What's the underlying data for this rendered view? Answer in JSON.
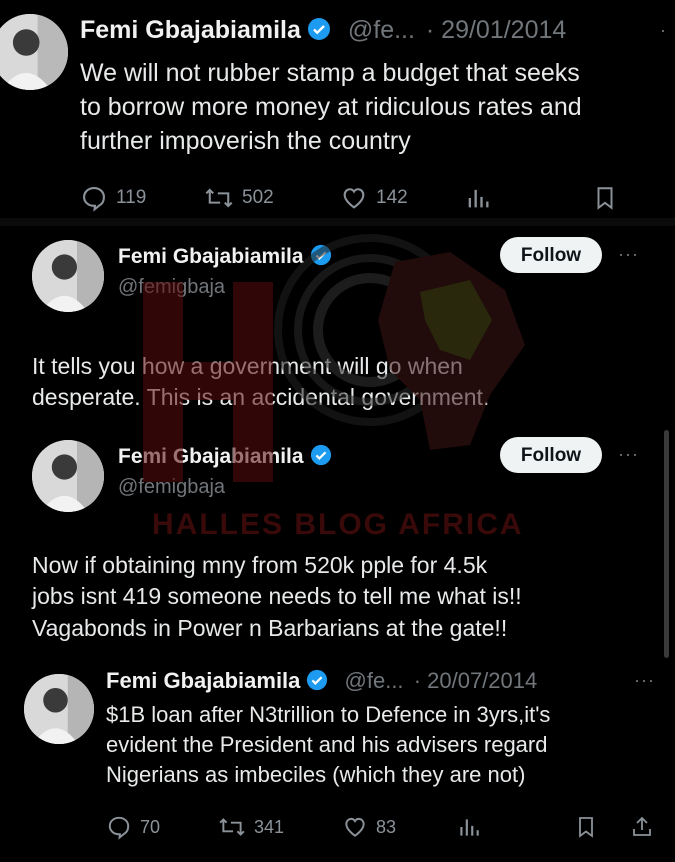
{
  "tweets": [
    {
      "name": "Femi Gbajabiamila",
      "handle_short": "@fe...",
      "date": "· 29/01/2014",
      "text_lines": [
        "We will not rubber stamp a budget that seeks",
        "to borrow more money at ridiculous rates and",
        "further impoverish the country"
      ],
      "replies": "119",
      "retweets": "502",
      "likes": "142"
    },
    {
      "name": "Femi Gbajabiamila",
      "handle": "@femigbaja",
      "follow_label": "Follow",
      "dots": "···",
      "text_lines": [
        "It tells you how a government will go when",
        "desperate. This is an accidental government."
      ]
    },
    {
      "name": "Femi Gbajabiamila",
      "handle": "@femigbaja",
      "follow_label": "Follow",
      "dots": "···",
      "text_lines": [
        "Now if obtaining mny from 520k pple for 4.5k",
        "jobs isnt 419  someone needs to tell me what is!!",
        "Vagabonds in Power n Barbarians at the gate!!"
      ]
    },
    {
      "name": "Femi Gbajabiamila",
      "handle_short": "@fe...",
      "date": "· 20/07/2014",
      "dots": "···",
      "text_lines": [
        "$1B loan after N3trillion to Defence in 3yrs,it's",
        "evident the President and his advisers regard",
        "Nigerians as imbeciles (which they are not)"
      ],
      "replies": "70",
      "retweets": "341",
      "likes": "83"
    }
  ],
  "watermark": {
    "text": "HALLES BLOG AFRICA"
  },
  "colors": {
    "accent": "#1d9bf0",
    "muted": "#71767b",
    "text": "#e7e9ea",
    "watermark": "#7a0e0e"
  }
}
